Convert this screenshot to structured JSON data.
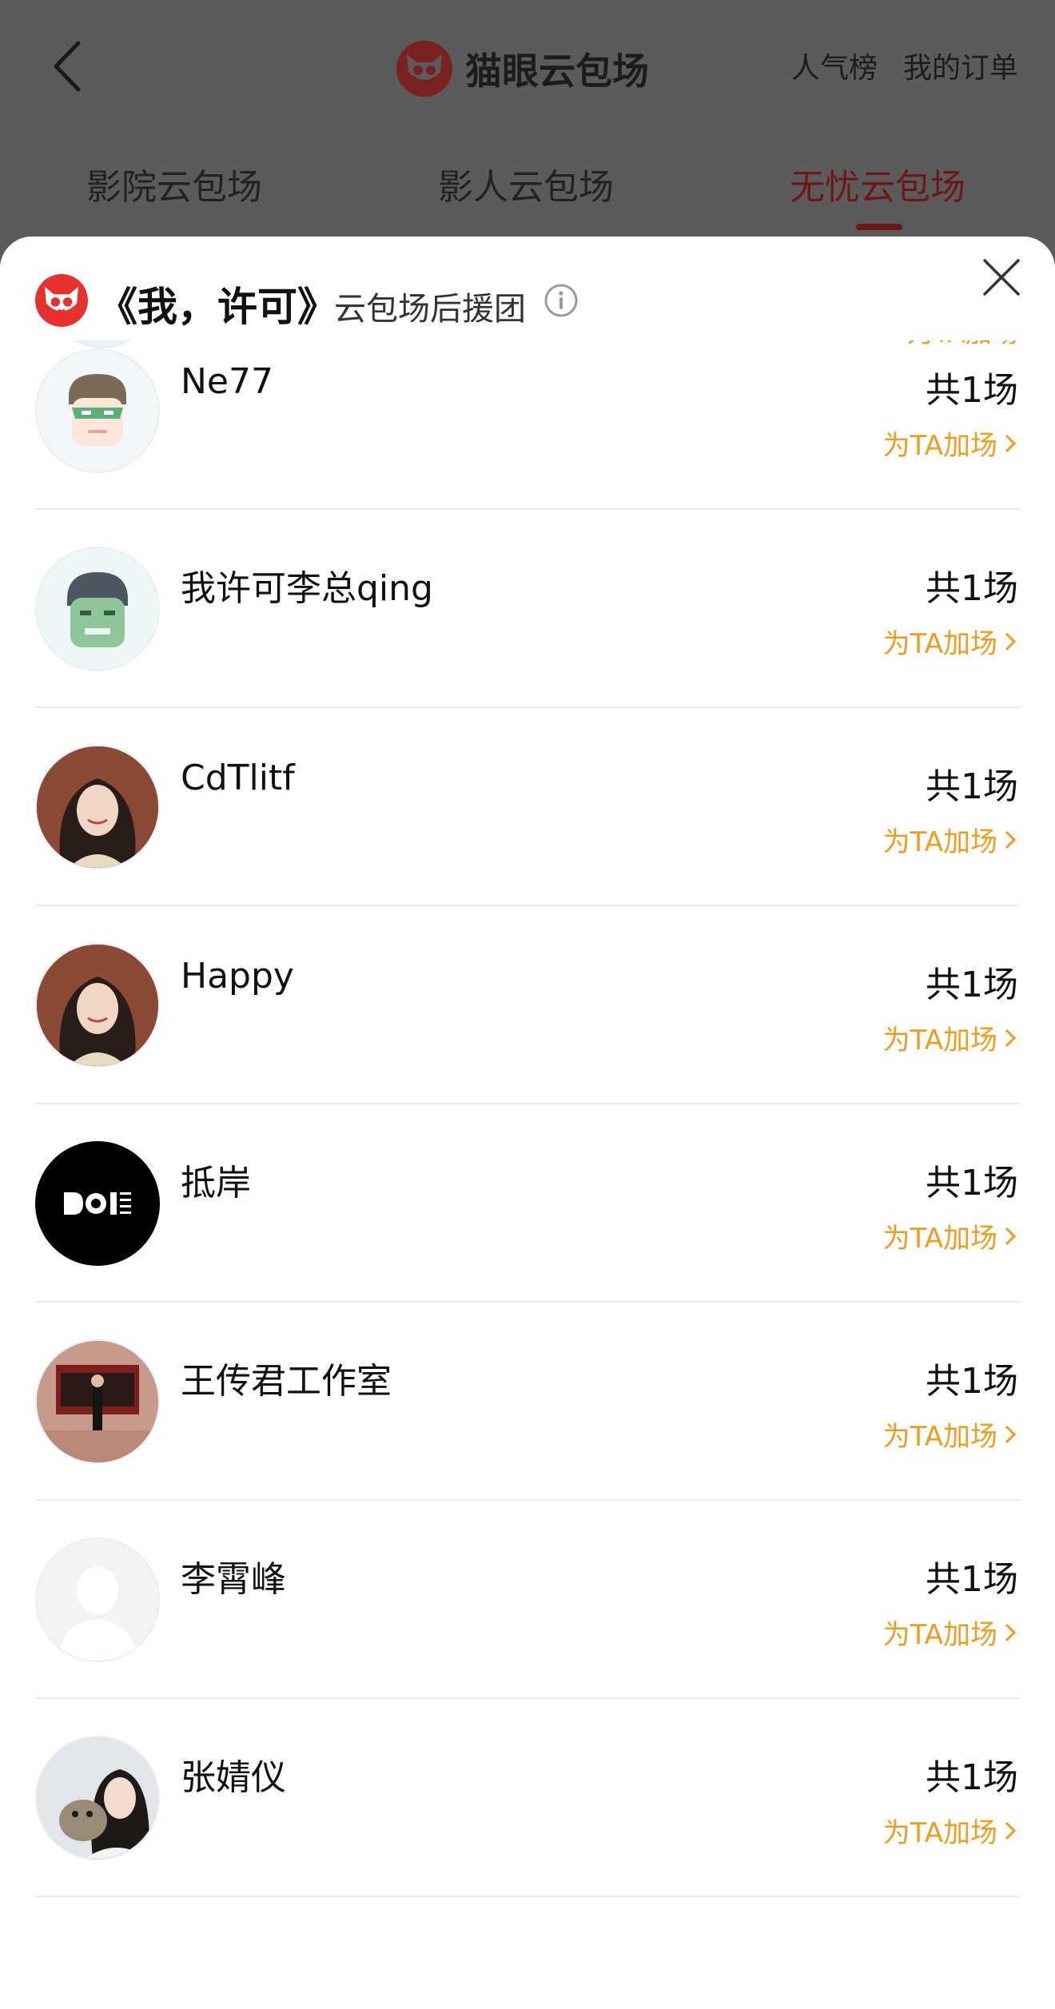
{
  "header": {
    "title": "猫眼云包场",
    "links": [
      "人气榜",
      "我的订单"
    ],
    "tabs": [
      "影院云包场",
      "影人云包场",
      "无忧云包场"
    ],
    "active_tab": "无忧云包场"
  },
  "sheet": {
    "title": "《我，许可》",
    "subtitle": "云包场后援团",
    "partial_link": "为TA加场"
  },
  "supporters": [
    {
      "name": "Ne77",
      "count": "共1场",
      "action": "为TA加场",
      "avatar": "masked-hero-avatar"
    },
    {
      "name": "我许可李总qing",
      "count": "共1场",
      "action": "为TA加场",
      "avatar": "green-hero-avatar"
    },
    {
      "name": "CdTlitf",
      "count": "共1场",
      "action": "为TA加场",
      "avatar": "woman-photo-avatar"
    },
    {
      "name": "Happy",
      "count": "共1场",
      "action": "为TA加场",
      "avatar": "woman-photo-avatar"
    },
    {
      "name": "抵岸",
      "count": "共1场",
      "action": "为TA加场",
      "avatar": "doi-logo-avatar"
    },
    {
      "name": "王传君工作室",
      "count": "共1场",
      "action": "为TA加场",
      "avatar": "stage-photo-avatar"
    },
    {
      "name": "李霄峰",
      "count": "共1场",
      "action": "为TA加场",
      "avatar": "default-user-avatar"
    },
    {
      "name": "张婧仪",
      "count": "共1场",
      "action": "为TA加场",
      "avatar": "woman-dog-photo-avatar"
    }
  ]
}
